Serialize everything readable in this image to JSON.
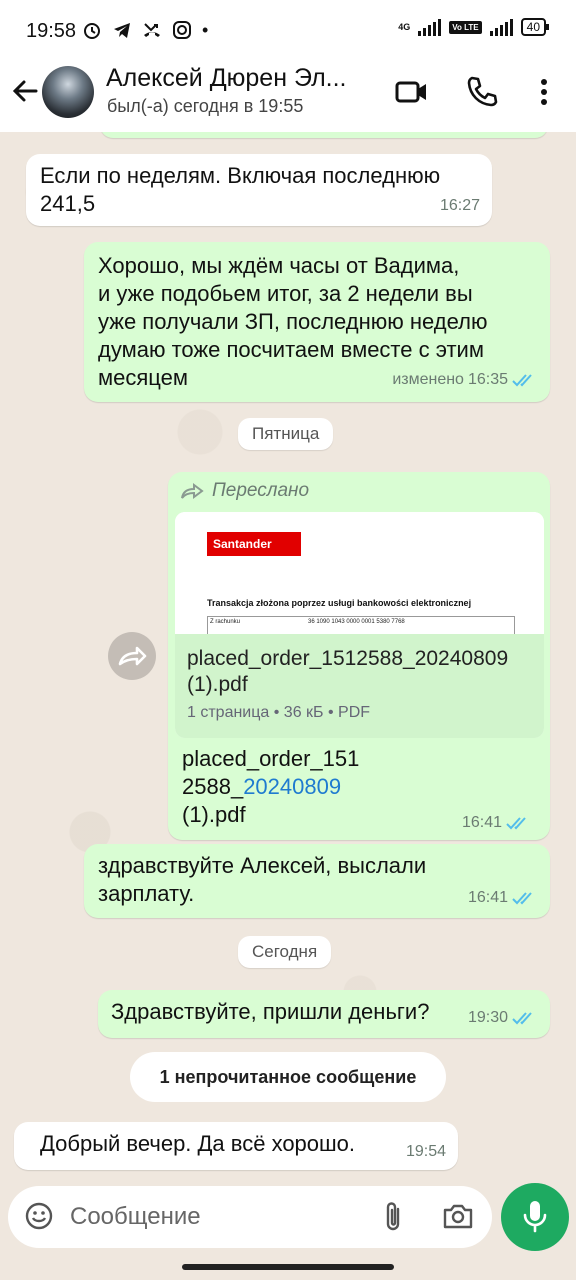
{
  "status_bar": {
    "time": "19:58",
    "icons": [
      "alarm-icon",
      "telegram-icon",
      "missed-call-icon",
      "instagram-icon",
      "dot-icon"
    ],
    "network_label": "4G",
    "volte_label": "Vo LTE",
    "battery": "40"
  },
  "header": {
    "contact_name": "Алексей Дюрен Эл...",
    "last_seen": "был(-а) сегодня в 19:55"
  },
  "messages": [
    {
      "direction": "in",
      "text_lines": [
        "Если по неделям. Включая последнюю",
        "241,5"
      ],
      "time": "16:27"
    },
    {
      "direction": "out",
      "text_lines": [
        "Хорошо, мы ждём часы от Вадима,",
        "и уже подобьем итог, за 2 недели вы",
        "уже получали ЗП, последнюю неделю",
        "думаю тоже посчитаем вместе с этим",
        "месяцем"
      ],
      "edited_label": "изменено",
      "time": "16:35"
    }
  ],
  "date_friday": "Пятница",
  "forwarded": {
    "label": "Переслано",
    "preview_brand": "Santander",
    "preview_heading": "Transakcja złożona poprzez usługi bankowości elektronicznej",
    "preview_row_label": "Z rachunku",
    "preview_row_value": "36 1090 1043 0000 0001 5380 7768",
    "file_name": "placed_order_1512588_20240809 (1).pdf",
    "file_details": "1 страница • 36 кБ • PDF",
    "caption_part1": "placed_order_151",
    "caption_part2": "2588_",
    "caption_link": "20240809",
    "caption_part3": "(1).pdf",
    "time": "16:41"
  },
  "salary_message": {
    "text_lines": [
      "здравствуйте Алексей, выслали",
      "зарплату."
    ],
    "time": "16:41"
  },
  "date_today": "Сегодня",
  "money_message": {
    "text": "Здравствуйте, пришли деньги?",
    "time": "19:30"
  },
  "unread_label": "1 непрочитанное сообщение",
  "last_message": {
    "text": "Добрый вечер. Да всё хорошо.",
    "time": "19:54"
  },
  "input": {
    "placeholder": "Сообщение"
  },
  "colors": {
    "outgoing": "#d9fdd3",
    "incoming": "#ffffff",
    "accent": "#1eaa61",
    "ticks": "#53bdeb",
    "link": "#1f7bd0"
  }
}
